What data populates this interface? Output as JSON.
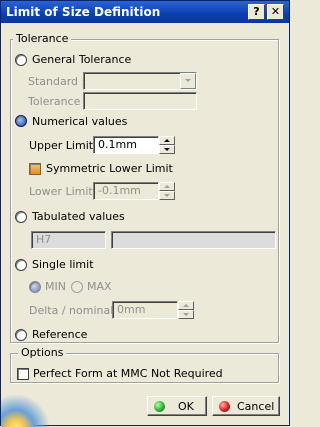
{
  "window": {
    "title": "Limit of Size Definition"
  },
  "titlebar": {
    "help": "?",
    "close": "✕"
  },
  "tolerance": {
    "legend": "Tolerance",
    "general_label": "General Tolerance",
    "standard_label": "Standard :",
    "standard_value": "",
    "tolerance_label": "Tolerance :",
    "tolerance_value": "",
    "numerical_label": "Numerical values",
    "upper_label": "Upper Limit :",
    "upper_value": "0.1mm",
    "symmetric_label": "Symmetric Lower Limit",
    "lower_label": "Lower Limit :",
    "lower_value": "-0.1mm",
    "tabulated_label": "Tabulated values",
    "tabulated_value": "H7",
    "tabulated_value2": "",
    "single_label": "Single limit",
    "min_label": "MIN",
    "max_label": "MAX",
    "delta_label": "Delta / nominal :",
    "delta_value": "0mm",
    "reference_label": "Reference"
  },
  "options": {
    "legend": "Options",
    "perfect_form_label": "Perfect Form at MMC Not Required"
  },
  "buttons": {
    "ok": "OK",
    "cancel": "Cancel"
  },
  "colors": {
    "title_bar": "#0a3fb0",
    "dialog_bg": "#ece9d8",
    "ok_dot": "#2bb32b",
    "cancel_dot": "#d62020"
  }
}
